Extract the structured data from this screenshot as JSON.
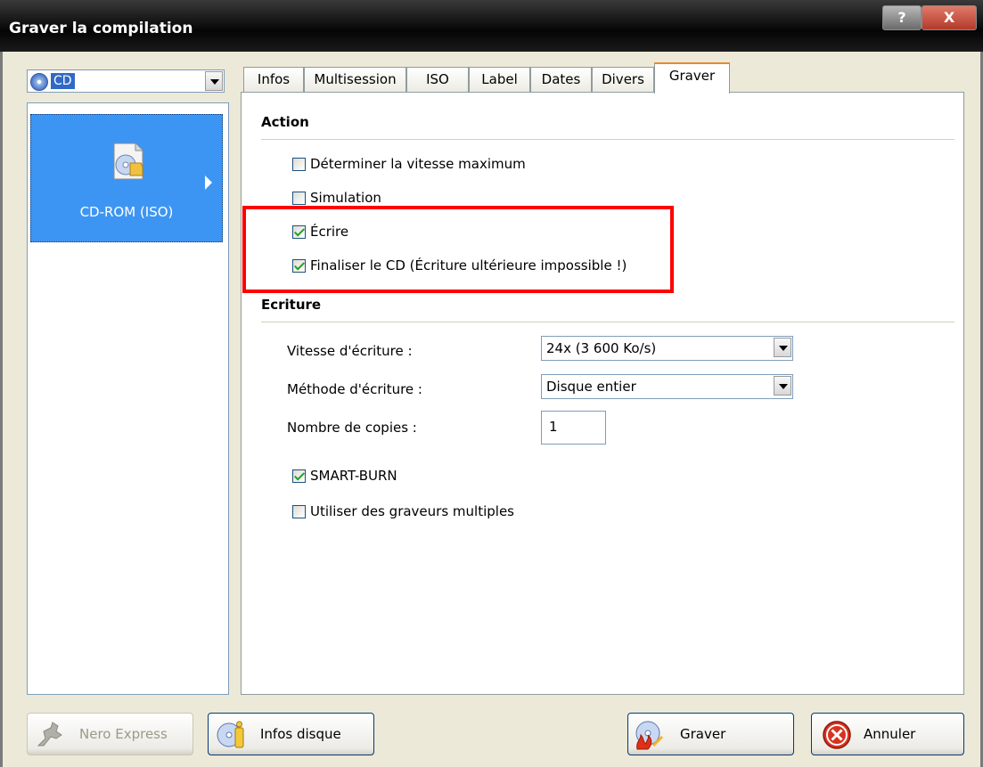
{
  "window": {
    "title": "Graver la compilation",
    "help_btn": "?",
    "close_btn": "X"
  },
  "media_combo": {
    "value": "CD"
  },
  "left_panel": {
    "item_label": "CD-ROM (ISO)"
  },
  "tabs": [
    {
      "label": "Infos"
    },
    {
      "label": "Multisession"
    },
    {
      "label": "ISO"
    },
    {
      "label": "Label"
    },
    {
      "label": "Dates"
    },
    {
      "label": "Divers"
    },
    {
      "label": "Graver"
    }
  ],
  "action": {
    "title": "Action",
    "options": [
      {
        "label": "Déterminer la vitesse maximum",
        "checked": false
      },
      {
        "label": "Simulation",
        "checked": false
      },
      {
        "label": "Écrire",
        "checked": true
      },
      {
        "label": "Finaliser le CD (Écriture ultérieure impossible !)",
        "checked": true
      }
    ]
  },
  "ecriture": {
    "title": "Ecriture",
    "speed_label": "Vitesse d'écriture :",
    "speed_value": "24x (3 600 Ko/s)",
    "method_label": "Méthode d'écriture :",
    "method_value": "Disque entier",
    "copies_label": "Nombre de copies :",
    "copies_value": "1",
    "smart_burn": {
      "label": "SMART-BURN",
      "checked": true
    },
    "multi": {
      "label": "Utiliser des graveurs multiples",
      "checked": false
    }
  },
  "buttons": {
    "nero_express": "Nero Express",
    "infos_disque": "Infos disque",
    "graver": "Graver",
    "annuler": "Annuler"
  },
  "colors": {
    "selection": "#3d95f3",
    "highlight_frame": "#ff0000",
    "active_tab_accent": "#e68b2c"
  }
}
